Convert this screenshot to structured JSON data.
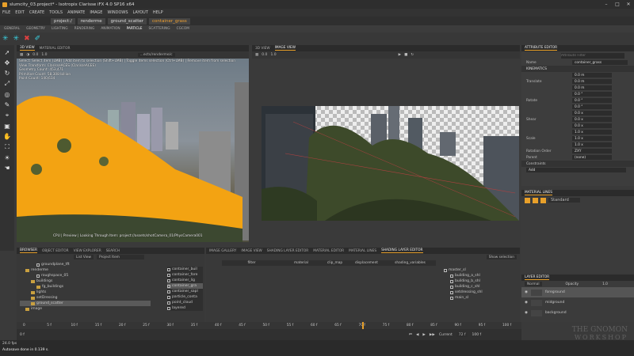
{
  "window": {
    "title": "slumcity_03.project* - Isotropix Clarisse iFX 4.0 SP16 x64",
    "controls": [
      "–",
      "□",
      "✕"
    ]
  },
  "menu": [
    "FILE",
    "EDIT",
    "CREATE",
    "TOOLS",
    "ANIMATE",
    "IMAGE",
    "WINDOWS",
    "LAYOUT",
    "HELP"
  ],
  "path": {
    "segments": [
      "project:/",
      "renderme",
      "ground_scatter"
    ],
    "current": "container_grass"
  },
  "module_tabs": [
    "GENERAL",
    "GEOMETRY",
    "LIGHTING",
    "RENDERING",
    "ANIMATION",
    "PARTICLE",
    "SCATTERING",
    "CGCOM"
  ],
  "active_module": "PARTICLE",
  "left_viewport": {
    "tabs": [
      "3D VIEW",
      "MATERIAL EDITOR"
    ],
    "zoom": "0.0",
    "scale": "1.0",
    "path_field": "...ects/renderme/c",
    "info_lines": [
      "Select: Select item (LMB) | Add item to selection (Shift+LMB) | Toggle items selection (Ctrl+LMB) | Remove item from selection",
      "View Transform: ClarisseACES (ClarisseACES)",
      "Geometry Count: 453,471",
      "Primitive Count: 58,308 billion",
      "Point Count: 140,614"
    ],
    "footer": "CPU | Preview | Looking Through Item: project://assets/shotCamera_01/PhysCamera001"
  },
  "right_viewport": {
    "tabs": [
      "3D VIEW",
      "IMAGE VIEW"
    ],
    "zoom": "0.0",
    "scale": "1.0"
  },
  "attribute_editor": {
    "title": "ATTRIBUTE EDITOR",
    "search_placeholder": "Attribute Filter",
    "name_label": "Name",
    "name_value": "container_grass",
    "section": "KINEMATICS",
    "groups": [
      {
        "label": "Translate",
        "values": [
          "0.0 m",
          "0.0 m",
          "0.0 m"
        ]
      },
      {
        "label": "Rotate",
        "values": [
          "0.0 °",
          "0.0 °",
          "0.0 °"
        ]
      },
      {
        "label": "Shear",
        "values": [
          "0.0 x",
          "0.0 x",
          "0.0 x"
        ]
      },
      {
        "label": "Scale",
        "values": [
          "1.0 x",
          "1.0 x",
          "1.0 x"
        ]
      }
    ],
    "rotation_order_label": "Rotation Order",
    "rotation_order_value": "ZXY",
    "parent_label": "Parent",
    "parent_value": "(none)",
    "constraints_label": "Constraints",
    "add_label": "Add"
  },
  "material_lines": {
    "title": "MATERIAL LINES",
    "dropdown": "Standard"
  },
  "layer_editor": {
    "title": "LAYER EDITOR",
    "mode": "Normal",
    "opacity_label": "Opacity",
    "opacity_value": "1.0",
    "layers": [
      "foreground",
      "midground",
      "background"
    ]
  },
  "browser": {
    "tabs": [
      "BROWSER",
      "OBJECT EDITOR",
      "VIEW EXPLORER",
      "SEARCH"
    ],
    "view_mode": "List View",
    "project_item": "Project Item",
    "tree": [
      {
        "label": "groundplane_tft",
        "indent": 3,
        "kind": "file"
      },
      {
        "label": "renderme",
        "indent": 1,
        "kind": "folder"
      },
      {
        "label": "roughspace_05",
        "indent": 3,
        "kind": "file"
      },
      {
        "label": "buildings",
        "indent": 2,
        "kind": "folder"
      },
      {
        "label": "fg_buildings",
        "indent": 3,
        "kind": "folder"
      },
      {
        "label": "lights",
        "indent": 2,
        "kind": "folder"
      },
      {
        "label": "setDressing",
        "indent": 2,
        "kind": "folder"
      },
      {
        "label": "ground_scatter",
        "indent": 2,
        "kind": "folder",
        "selected": true
      },
      {
        "label": "image",
        "indent": 1,
        "kind": "folder"
      }
    ],
    "items": [
      "container_buil",
      "container_fore",
      "container_lig",
      "container_gra",
      "container_sapl",
      "particle_conta",
      "point_cloud",
      "layered"
    ],
    "selected_item": "container_gra"
  },
  "shading": {
    "tabs": [
      "IMAGE GALLERY",
      "IMAGE VIEW",
      "SHADING LAYER EDITOR",
      "MATERIAL EDITOR",
      "MATERIAL LINES",
      "SHADING LAYER EDITOR"
    ],
    "show_selection": "Show selection",
    "columns": [
      "filter",
      "material",
      "clip_map",
      "displacement",
      "shading_variables"
    ],
    "tree": [
      "master_sl",
      "building_a_shl",
      "building_b_shl",
      "building_c_shl",
      "setdressing_shl",
      "main_sl"
    ]
  },
  "timeline": {
    "ticks": [
      "0",
      "5 f",
      "10 f",
      "15 f",
      "20 f",
      "25 f",
      "30 f",
      "35 f",
      "40 f",
      "45 f",
      "50 f",
      "55 f",
      "60 f",
      "65 f",
      "70 f",
      "75 f",
      "80 f",
      "85 f",
      "90 f",
      "95 f",
      "100 f"
    ],
    "current_label": "Current",
    "current_value": "72 f",
    "start": "0 f",
    "end": "100 f"
  },
  "status": {
    "fps": "24.0 fps",
    "message": "Autosave done in 0.139 s."
  },
  "watermark": {
    "line1": "THE GNOMON",
    "line2": "WORKSHOP"
  },
  "colors": {
    "accent": "#e8a02a",
    "grass": "#f3a312"
  }
}
